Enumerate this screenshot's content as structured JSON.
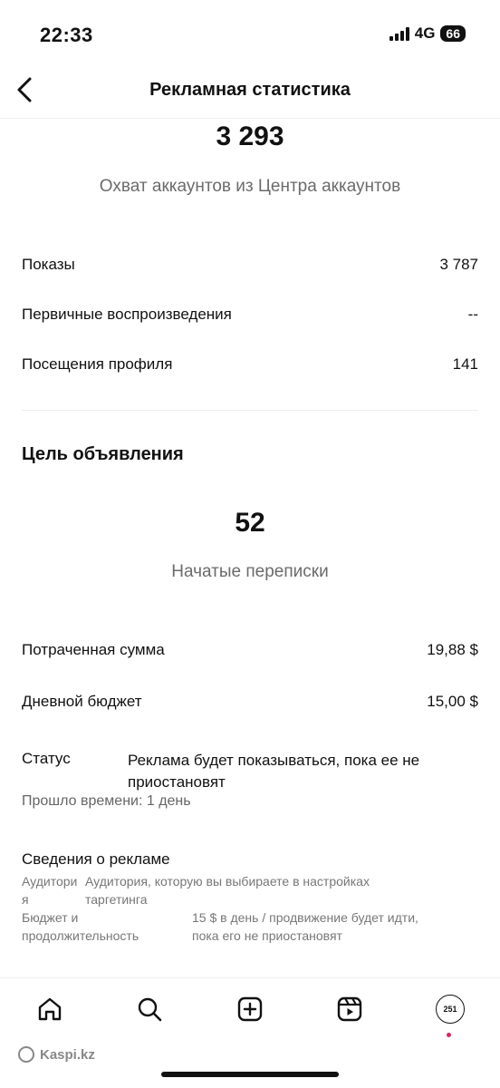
{
  "status_bar": {
    "time": "22:33",
    "network": "4G",
    "battery": "66"
  },
  "header": {
    "title": "Рекламная статистика"
  },
  "reach": {
    "value": "3 293",
    "caption": "Охват аккаунтов из Центра аккаунтов"
  },
  "metrics": [
    {
      "label": "Показы",
      "value": "3 787"
    },
    {
      "label": "Первичные воспроизведения",
      "value": "--"
    },
    {
      "label": "Посещения профиля",
      "value": "141"
    }
  ],
  "goal": {
    "title": "Цель объявления",
    "value": "52",
    "caption": "Начатые переписки"
  },
  "budget": [
    {
      "label": "Потраченная сумма",
      "value": "19,88 $"
    },
    {
      "label": "Дневной бюджет",
      "value": "15,00 $"
    }
  ],
  "status": {
    "label": "Статус",
    "text": "Реклама будет показываться, пока ее не приостановят",
    "elapsed": "Прошло времени: 1 день"
  },
  "ad_info": {
    "title": "Сведения о рекламе",
    "audience_label_1": "Аудитори",
    "audience_label_2": "я",
    "audience_value_1": "Аудитория, которую вы выбираете в настройках",
    "audience_value_2": "таргетинга",
    "budget_label_1": "Бюджет и",
    "budget_label_2": "продолжительность",
    "budget_value_1": "15 $ в день / продвижение будет идти,",
    "budget_value_2": "пока его не приостановят"
  },
  "tabbar": {
    "avatar_text": "251"
  },
  "watermark": "Kaspi.kz"
}
